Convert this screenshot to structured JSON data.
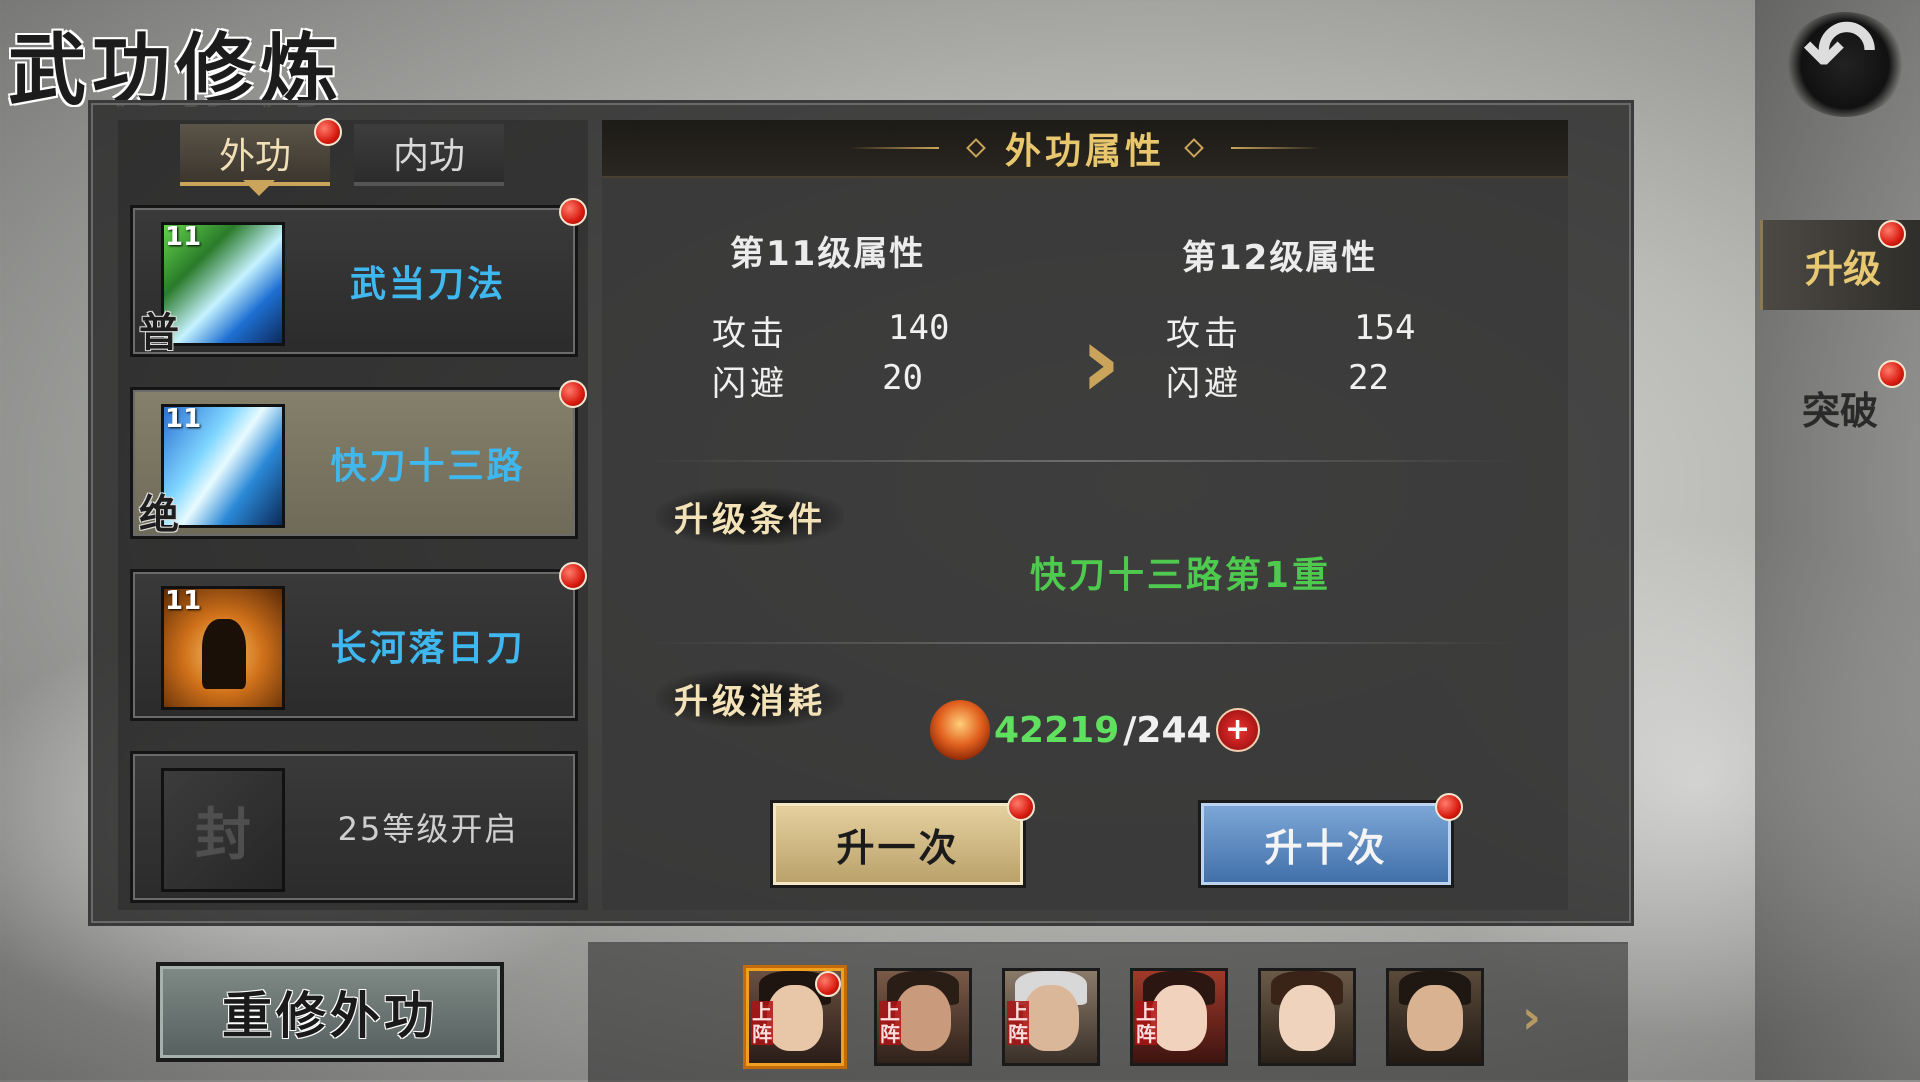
{
  "window": {
    "title": "武功修炼"
  },
  "side_tabs": [
    {
      "label": "升级",
      "active": true
    },
    {
      "label": "突破",
      "active": false
    }
  ],
  "kungfu_tabs": [
    {
      "label": "外功",
      "active": true
    },
    {
      "label": "内功",
      "active": false
    }
  ],
  "skills": [
    {
      "level": "11",
      "rank": "普",
      "name": "武当刀法",
      "icon": "blade-green-icon",
      "selected": false
    },
    {
      "level": "11",
      "rank": "绝",
      "name": "快刀十三路",
      "icon": "blade-blue-icon",
      "selected": true
    },
    {
      "level": "11",
      "rank": "",
      "name": "长河落日刀",
      "icon": "fighter-icon",
      "selected": false
    },
    {
      "locked_icon_text": "封",
      "name": "25等级开启",
      "icon": "lock-seal-icon",
      "locked": true
    }
  ],
  "rebuild_button": "重修外功",
  "attributes": {
    "header": "外功属性",
    "current": {
      "title": "第11级属性",
      "stats": [
        {
          "name": "攻击",
          "value": "140"
        },
        {
          "name": "闪避",
          "value": "20"
        }
      ]
    },
    "next": {
      "title": "第12级属性",
      "stats": [
        {
          "name": "攻击",
          "value": "154"
        },
        {
          "name": "闪避",
          "value": "22"
        }
      ]
    }
  },
  "upgrade": {
    "condition_label": "升级条件",
    "condition_value": "快刀十三路第1重",
    "cost_label": "升级消耗",
    "cost_have": "42219",
    "cost_need": "/244",
    "cost_plus": "+",
    "once_button": "升一次",
    "ten_button": "升十次"
  },
  "heroes": [
    {
      "tag": "上阵",
      "selected": true,
      "hair_color": "#1e1510"
    },
    {
      "tag": "上阵",
      "selected": false,
      "hair_color": "#2a1d16"
    },
    {
      "tag": "上阵",
      "selected": false,
      "hair_color": "#d8d8d8"
    },
    {
      "tag": "上阵",
      "selected": false,
      "hair_color": "#2b1612"
    },
    {
      "tag": "",
      "selected": false,
      "hair_color": "#3a2418"
    },
    {
      "tag": "",
      "selected": false,
      "hair_color": "#1f1712"
    }
  ],
  "colors": {
    "accent_gold": "#c9a45a",
    "skill_name": "#3fb8f0",
    "condition_green": "#4ecb4e",
    "cost_green": "#5fe05f"
  }
}
